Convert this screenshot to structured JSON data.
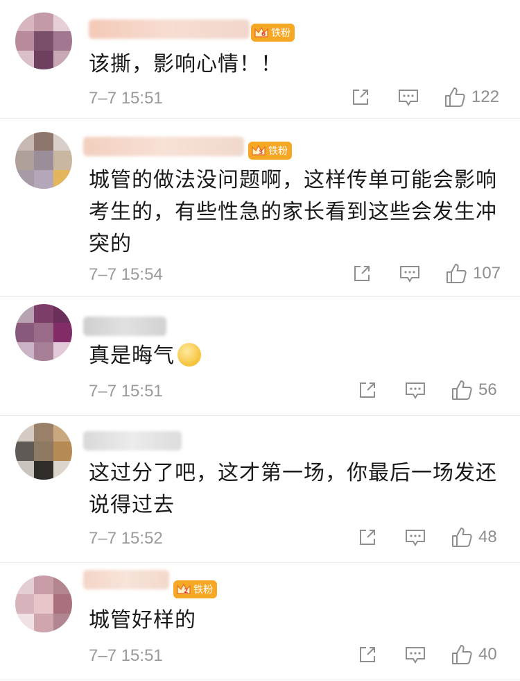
{
  "comments": [
    {
      "text": "该撕，影响心情！！",
      "time": "7–7 15:51",
      "likes": "122",
      "badge": {
        "label": "铁粉",
        "level": "6"
      }
    },
    {
      "text": "城管的做法没问题啊，这样传单可能会影响考生的，有些性急的家长看到这些会发生冲突的",
      "time": "7–7 15:54",
      "likes": "107",
      "badge": {
        "label": "铁粉",
        "level": "3"
      }
    },
    {
      "text": "真是晦气",
      "time": "7–7 15:51",
      "likes": "56",
      "emoji": "smirk-emoji"
    },
    {
      "text": "这过分了吧，这才第一场，你最后一场发还说得过去",
      "time": "7–7 15:52",
      "likes": "48"
    },
    {
      "text": "城管好样的",
      "time": "7–7 15:51",
      "likes": "40",
      "badge": {
        "label": "铁粉",
        "level": "2"
      }
    }
  ],
  "icons": {
    "share": "share-icon",
    "comment": "comment-icon",
    "like": "thumbs-up-icon",
    "crown": "crown-icon"
  },
  "colors": {
    "badge": "#f6a723",
    "meta": "#9a9a9a",
    "divider": "#ebebeb"
  }
}
